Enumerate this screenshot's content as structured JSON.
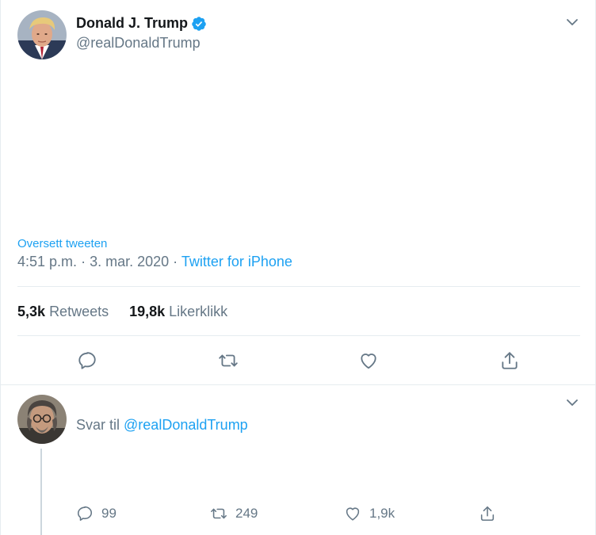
{
  "colors": {
    "link": "#1da1f2",
    "muted": "#657786",
    "text": "#14171a",
    "divider": "#e6ecf0"
  },
  "tweet": {
    "author_name": "Donald J. Trump",
    "author_handle": "@realDonaldTrump",
    "verified_icon": "verified-badge-icon",
    "translate_label": "Oversett tweeten",
    "time": "4:51 p.m.",
    "separator": "·",
    "date": "3. mar. 2020",
    "source": "Twitter for iPhone",
    "retweets_count": "5,3k",
    "retweets_label": "Retweets",
    "likes_count": "19,8k",
    "likes_label": "Likerklikk",
    "actions": [
      "reply-icon",
      "retweet-icon",
      "like-icon",
      "share-icon"
    ]
  },
  "reply": {
    "prefix": "Svar til",
    "mention": "@realDonaldTrump",
    "reply_count": "99",
    "retweet_count": "249",
    "like_count": "1,9k"
  }
}
